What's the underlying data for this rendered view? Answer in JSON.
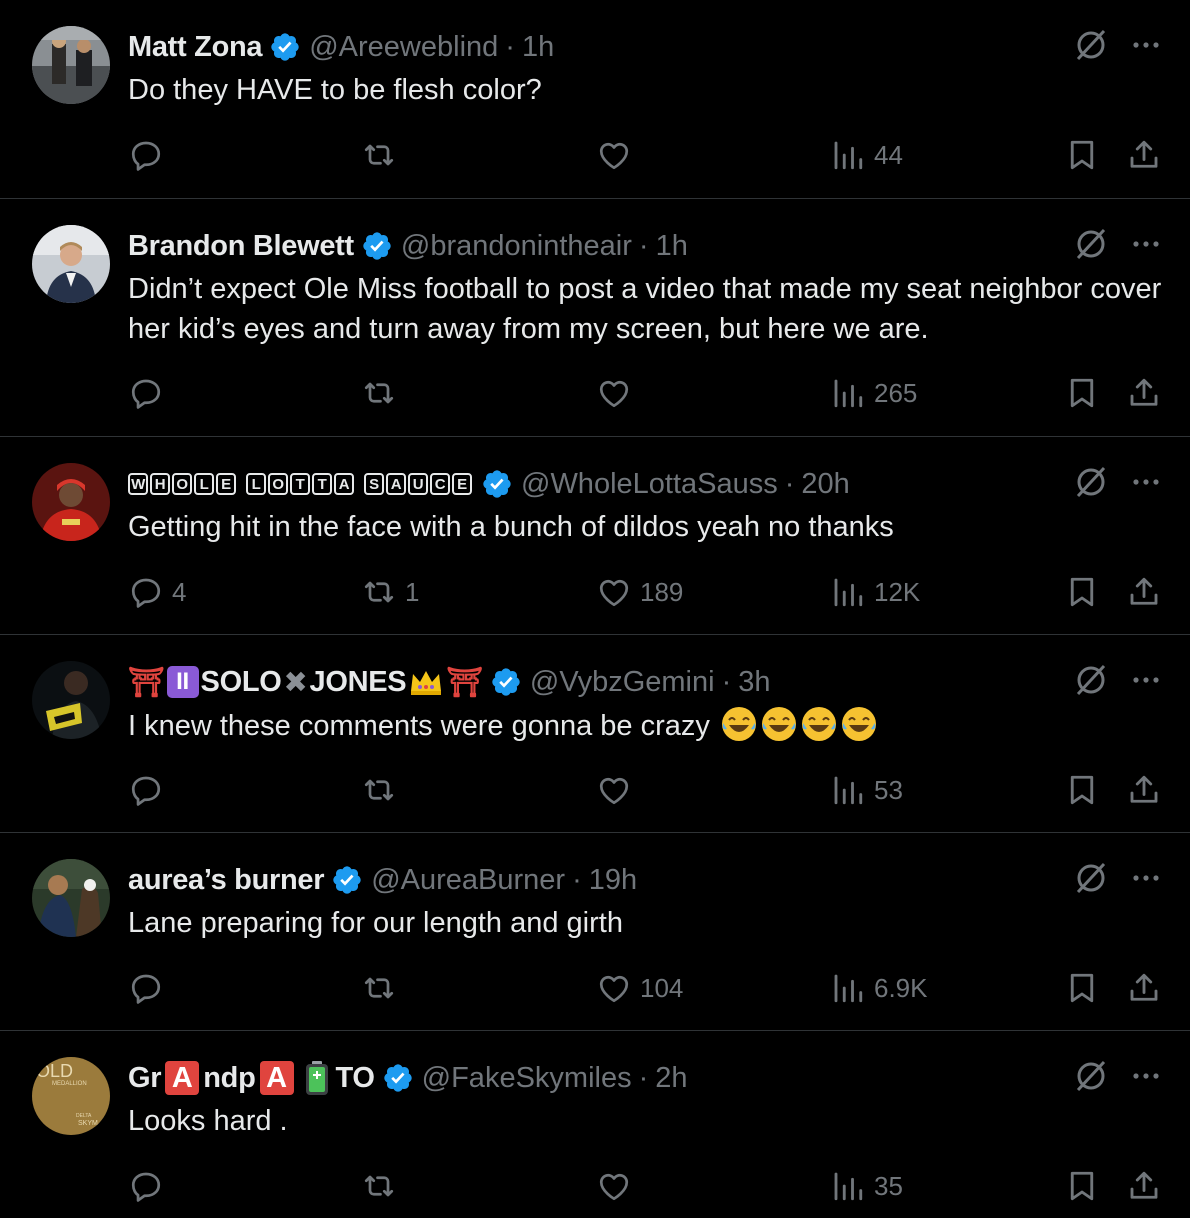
{
  "colors": {
    "background": "#000000",
    "text": "#e7e9ea",
    "muted": "#71767b",
    "verified": "#1d9bf0",
    "divider": "#2f3336"
  },
  "icons": {
    "verified": "verified-badge-icon",
    "grok": "grok-icon",
    "more": "more-icon",
    "reply": "reply-icon",
    "retweet": "retweet-icon",
    "like": "like-icon",
    "views": "views-icon",
    "bookmark": "bookmark-icon",
    "share": "share-icon"
  },
  "tweets": [
    {
      "name": "Matt Zona",
      "handle": "@Areeweblind",
      "dot": "·",
      "time": "1h",
      "text": "Do they HAVE to be flesh color?",
      "replies": "",
      "retweets": "",
      "likes": "",
      "views": "44"
    },
    {
      "name": "Brandon Blewett",
      "handle": "@brandonintheair",
      "dot": "·",
      "time": "1h",
      "text": "Didn’t expect Ole Miss football to post a video that made my seat neighbor cover her kid’s eyes and turn away from my screen, but here we are.",
      "replies": "",
      "retweets": "",
      "likes": "",
      "views": "265"
    },
    {
      "name": "🆆🅷🅾🅻🅴 🅻🅾🆃🆃🅰 🆂🅰🆄🅲🅴",
      "name_parts": [
        "W",
        "H",
        "O",
        "L",
        "E",
        " ",
        "L",
        "O",
        "T",
        "T",
        "A",
        " ",
        "S",
        "A",
        "U",
        "C",
        "E"
      ],
      "handle": "@WholeLottaSauss",
      "dot": "·",
      "time": "20h",
      "text": "Getting hit in the face with a bunch of dildos yeah no thanks",
      "replies": "4",
      "retweets": "1",
      "likes": "189",
      "views": "12K"
    },
    {
      "name": "⛩♊SOLO✖JONES👑⛩",
      "name_plain_1": "SOLO",
      "name_plain_2": "JONES",
      "name_gem": "II",
      "name_x": "✖",
      "name_torii": "⛩",
      "handle": "@VybzGemini",
      "dot": "·",
      "time": "3h",
      "text": "I knew these comments were gonna be crazy",
      "emoji": "😂😂😂😂",
      "replies": "",
      "retweets": "",
      "likes": "",
      "views": "53"
    },
    {
      "name": "aurea’s burner",
      "handle": "@AureaBurner",
      "dot": "·",
      "time": "19h",
      "text": "Lane preparing for our length and girth",
      "replies": "",
      "retweets": "",
      "likes": "104",
      "views": "6.9K"
    },
    {
      "name": "Gr🅰ndp🅰🔋TO",
      "name_p1": "Gr",
      "name_a": "A",
      "name_p2": "ndp",
      "name_p3": "TO",
      "handle": "@FakeSkymiles",
      "dot": "·",
      "time": "2h",
      "text": "Looks hard .",
      "replies": "",
      "retweets": "",
      "likes": "",
      "views": "35"
    }
  ],
  "avatar_texts": {
    "t6_line1": "OLD",
    "t6_line2": "MEDALLION",
    "t6_line3": "DELTA",
    "t6_line4": "SKYM"
  }
}
